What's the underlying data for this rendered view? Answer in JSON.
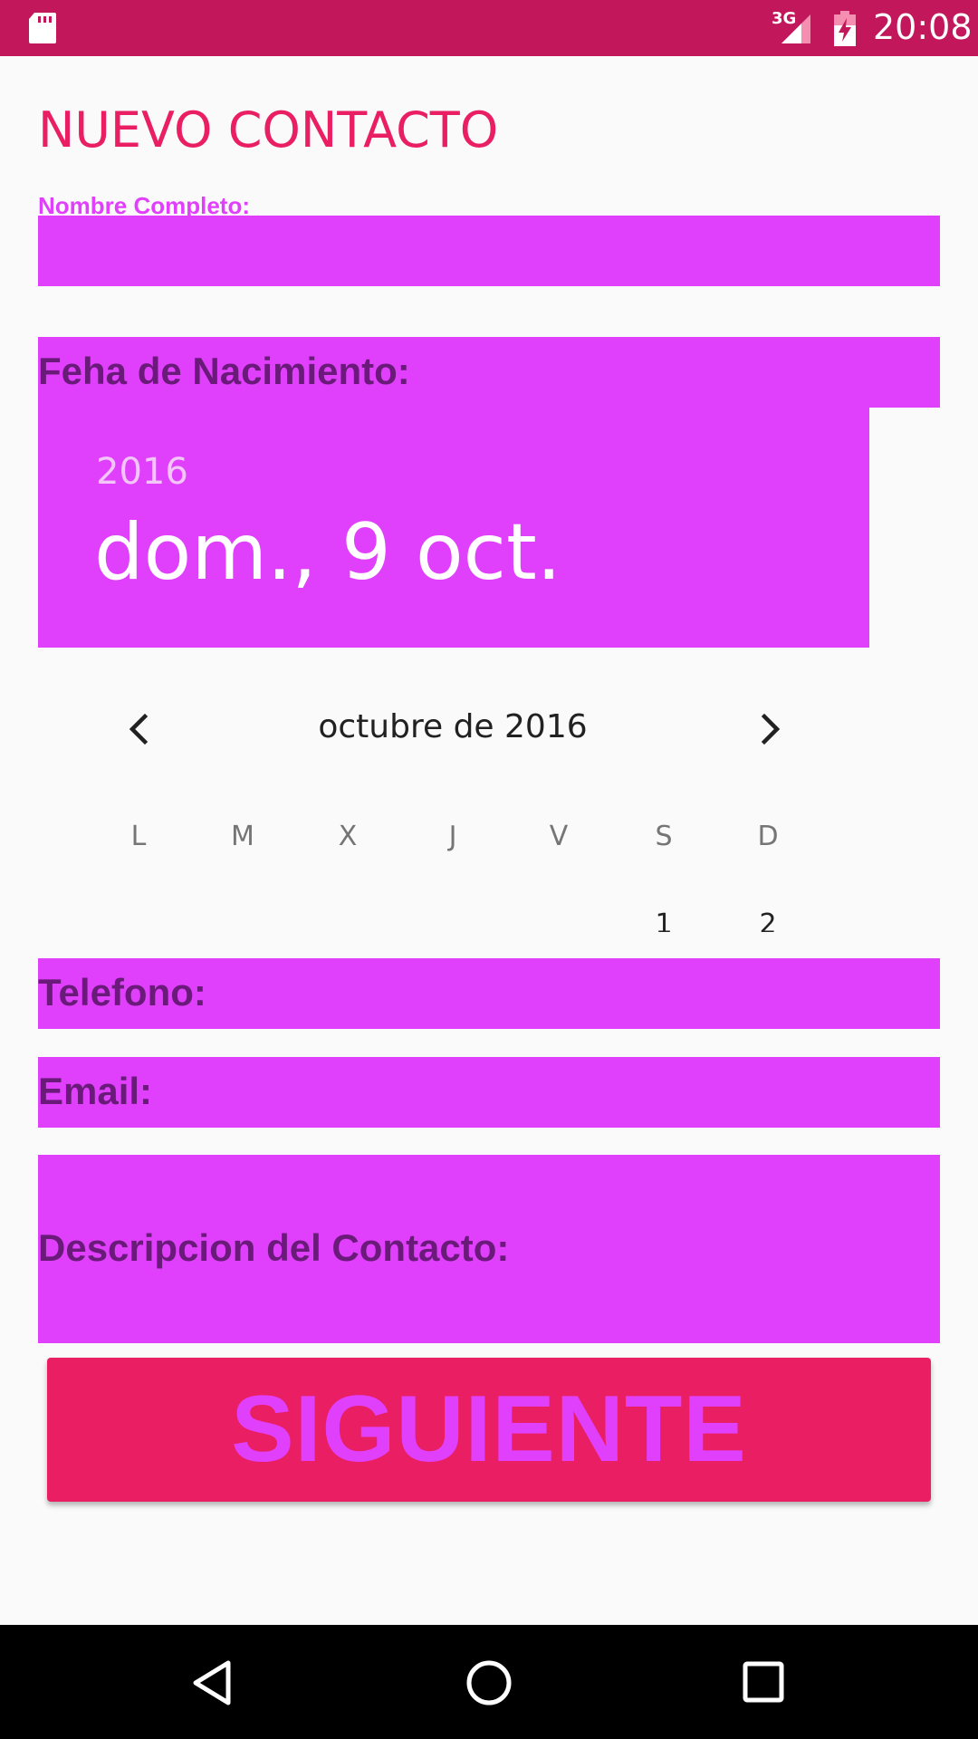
{
  "status_bar": {
    "network": "3G",
    "time": "20:08",
    "icons": [
      "sd-card-icon",
      "signal-icon",
      "battery-charging-icon"
    ]
  },
  "form": {
    "title": "NUEVO CONTACTO",
    "name_label": "Nombre Completo:",
    "name_value": "",
    "birth_label": "Feha de Nacimiento:",
    "phone_label": "Telefono:",
    "email_label": "Email:",
    "description_label": "Descripcion del Contacto:",
    "next_label": "SIGUIENTE"
  },
  "date_picker": {
    "year": "2016",
    "selected_date": "dom., 9 oct.",
    "month_title": "octubre de 2016",
    "weekdays": [
      "L",
      "M",
      "X",
      "J",
      "V",
      "S",
      "D"
    ],
    "visible_days": [
      "1",
      "2"
    ],
    "icons": [
      "chevron-left-icon",
      "chevron-right-icon"
    ]
  },
  "nav_bar": {
    "icons": [
      "back-icon",
      "home-icon",
      "recents-icon"
    ]
  },
  "colors": {
    "status_bar": "#c2185b",
    "accent": "#e91e63",
    "field_fill": "#e040fb",
    "label_dark": "#6a1b7a",
    "background": "#fafafa"
  }
}
